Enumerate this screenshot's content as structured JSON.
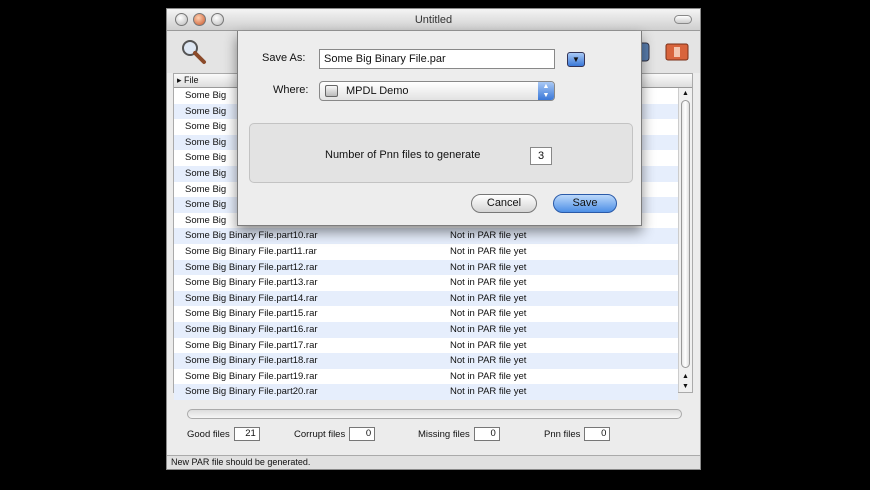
{
  "window": {
    "title": "Untitled"
  },
  "list": {
    "header": "File",
    "rows": [
      {
        "name": "Some Big",
        "status": ""
      },
      {
        "name": "Some Big",
        "status": ""
      },
      {
        "name": "Some Big",
        "status": ""
      },
      {
        "name": "Some Big",
        "status": ""
      },
      {
        "name": "Some Big",
        "status": ""
      },
      {
        "name": "Some Big",
        "status": ""
      },
      {
        "name": "Some Big",
        "status": ""
      },
      {
        "name": "Some Big",
        "status": ""
      },
      {
        "name": "Some Big",
        "status": ""
      },
      {
        "name": "Some Big Binary File.part10.rar",
        "status": "Not in PAR file yet"
      },
      {
        "name": "Some Big Binary File.part11.rar",
        "status": "Not in PAR file yet"
      },
      {
        "name": "Some Big Binary File.part12.rar",
        "status": "Not in PAR file yet"
      },
      {
        "name": "Some Big Binary File.part13.rar",
        "status": "Not in PAR file yet"
      },
      {
        "name": "Some Big Binary File.part14.rar",
        "status": "Not in PAR file yet"
      },
      {
        "name": "Some Big Binary File.part15.rar",
        "status": "Not in PAR file yet"
      },
      {
        "name": "Some Big Binary File.part16.rar",
        "status": "Not in PAR file yet"
      },
      {
        "name": "Some Big Binary File.part17.rar",
        "status": "Not in PAR file yet"
      },
      {
        "name": "Some Big Binary File.part18.rar",
        "status": "Not in PAR file yet"
      },
      {
        "name": "Some Big Binary File.part19.rar",
        "status": "Not in PAR file yet"
      },
      {
        "name": "Some Big Binary File.part20.rar",
        "status": "Not in PAR file yet"
      }
    ]
  },
  "stats": {
    "good_label": "Good files",
    "good_value": "21",
    "corrupt_label": "Corrupt files",
    "corrupt_value": "0",
    "missing_label": "Missing files",
    "missing_value": "0",
    "pnn_label": "Pnn files",
    "pnn_value": "0"
  },
  "status_text": "New PAR file should be generated.",
  "sheet": {
    "save_as_label": "Save As:",
    "save_as_value": "Some Big Binary File.par",
    "where_label": "Where:",
    "where_value": "MPDL Demo",
    "pnn_label": "Number of Pnn files to generate",
    "pnn_value": "3",
    "cancel_label": "Cancel",
    "save_label": "Save"
  },
  "colors": {
    "accent": "#4d8fe6",
    "row_alt": "#e6eefc"
  },
  "icons": [
    "magnifier-tool-icon",
    "toolbar-tool-icon",
    "toolbar-action-icon"
  ]
}
